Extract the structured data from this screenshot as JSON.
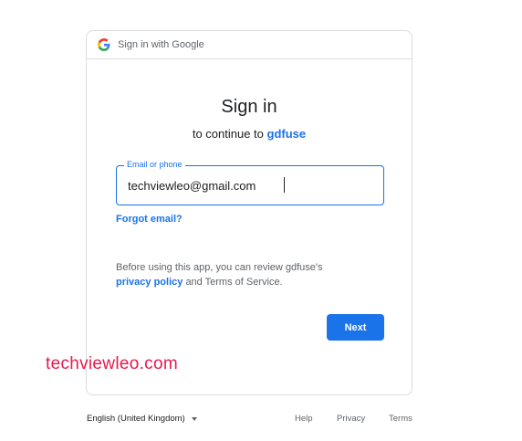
{
  "header": {
    "text": "Sign in with Google",
    "icon": "google-g-icon"
  },
  "signin": {
    "title": "Sign in",
    "subtitle_prefix": "to continue to",
    "app_name": "gdfuse"
  },
  "email_field": {
    "label": "Email or phone",
    "value": "techviewleo@gmail.com"
  },
  "forgot_email": "Forgot email?",
  "notice": {
    "text_before": "Before using this app, you can review gdfuse's",
    "privacy_link": "privacy policy",
    "text_after": "and Terms of Service."
  },
  "next_button": "Next",
  "watermark": "techviewleo.com",
  "footer": {
    "language": "English (United Kingdom)",
    "help": "Help",
    "privacy": "Privacy",
    "terms": "Terms"
  },
  "colors": {
    "accent": "#1a73e8",
    "border": "#dadce0",
    "watermark": "#e8194d"
  }
}
